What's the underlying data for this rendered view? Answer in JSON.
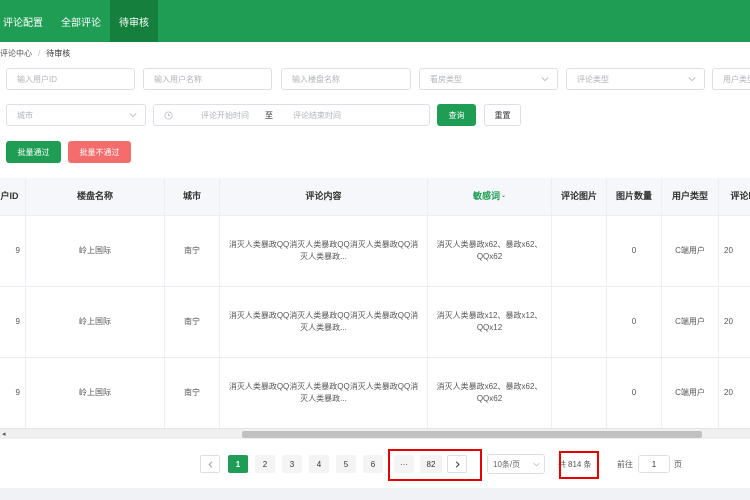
{
  "nav": {
    "tabs": [
      {
        "label": "评论配置"
      },
      {
        "label": "全部评论"
      },
      {
        "label": "待审核"
      }
    ]
  },
  "breadcrumb": {
    "parent": "评论中心",
    "separator": "/",
    "current": "待审核"
  },
  "filters": {
    "user_id_placeholder": "输入用户ID",
    "user_name_placeholder": "输入用户名称",
    "building_placeholder": "输入楼盘名称",
    "house_type_placeholder": "看房类型",
    "comment_type_placeholder": "评论类型",
    "user_type_placeholder": "用户类型",
    "city_placeholder": "城市",
    "start_time_placeholder": "评论开始时间",
    "range_separator": "至",
    "end_time_placeholder": "评论结束时间",
    "query_label": "查询",
    "reset_label": "重置"
  },
  "actions": {
    "batch_pass": "批量通过",
    "batch_reject": "批量不通过"
  },
  "table": {
    "columns": [
      "用户ID",
      "楼盘名称",
      "城市",
      "评论内容",
      "敏感词",
      "评论图片",
      "图片数量",
      "用户类型",
      "评论时间"
    ],
    "rows": [
      {
        "id": "9",
        "building": "岭上国际",
        "city": "南宁",
        "content": "消灭人类暴政QQ消灭人类暴政QQ消灭人类暴政QQ消灭人类暴政...",
        "sensitive": "消灭人类暴政x62、暴政x62、QQx62",
        "image": "",
        "image_count": "0",
        "user_type": "C端用户",
        "time": "20"
      },
      {
        "id": "9",
        "building": "岭上国际",
        "city": "南宁",
        "content": "消灭人类暴政QQ消灭人类暴政QQ消灭人类暴政QQ消灭人类暴政...",
        "sensitive": "消灭人类暴政x12、暴政x12、QQx12",
        "image": "",
        "image_count": "0",
        "user_type": "C端用户",
        "time": "20"
      },
      {
        "id": "9",
        "building": "岭上国际",
        "city": "南宁",
        "content": "消灭人类暴政QQ消灭人类暴政QQ消灭人类暴政QQ消灭人类暴政...",
        "sensitive": "消灭人类暴政x62、暴政x62、QQx62",
        "image": "",
        "image_count": "0",
        "user_type": "C端用户",
        "time": "20"
      }
    ]
  },
  "pagination": {
    "pages": [
      "1",
      "2",
      "3",
      "4",
      "5",
      "6"
    ],
    "current": "1",
    "ellipsis": "···",
    "last_page": "82",
    "page_size": "10条/页",
    "total_prefix": "共",
    "total": "814",
    "total_suffix": "条",
    "goto_label": "前往",
    "goto_value": "1",
    "goto_suffix": "页"
  },
  "colors": {
    "brand": "#1f9d55",
    "danger": "#f56c6c",
    "highlight_box": "#e60000"
  }
}
